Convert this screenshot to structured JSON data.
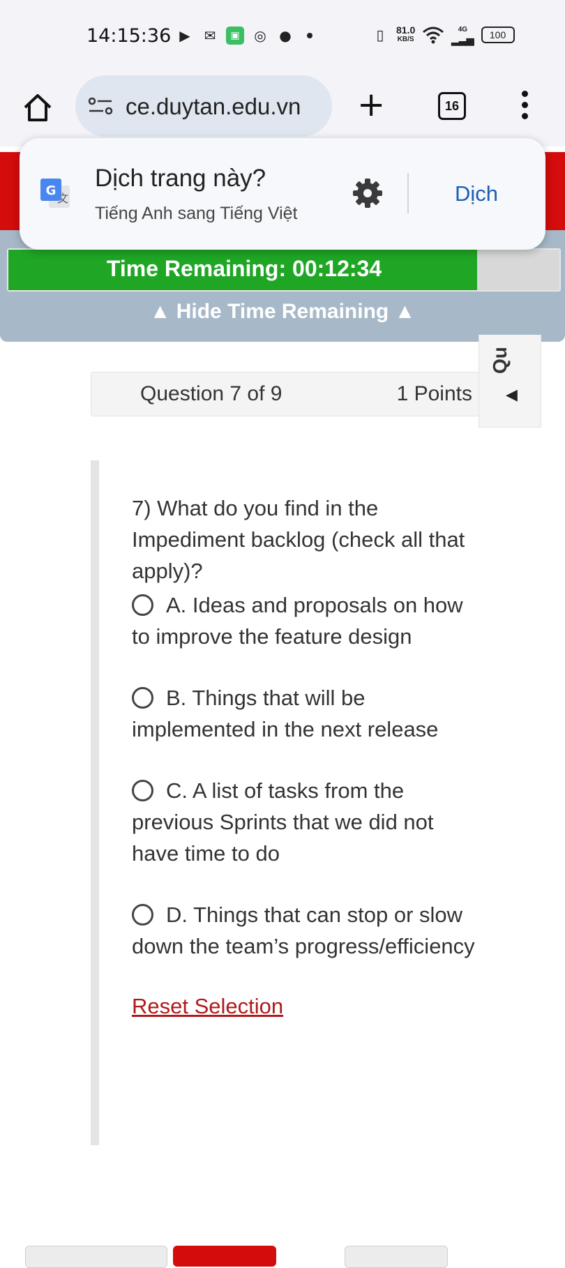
{
  "status_bar": {
    "time": "14:15:36",
    "net_speed_value": "81.0",
    "net_speed_unit": "KB/S",
    "network_type": "4G",
    "battery": "100",
    "icons": [
      "video-icon",
      "gmail-icon",
      "app-icon",
      "instagram-icon",
      "messenger-icon",
      "vibrate-icon",
      "wifi-icon",
      "signal-icon",
      "battery-icon"
    ]
  },
  "browser": {
    "url": "ce.duytan.edu.vn",
    "tab_count": "16"
  },
  "translate_popup": {
    "title": "Dịch trang này?",
    "subtitle": "Tiếng Anh sang Tiếng Việt",
    "action": "Dịch"
  },
  "timer": {
    "text": "Time Remaining: 00:12:34",
    "toggle": "▲ Hide Time Remaining ▲",
    "progress": 0.85,
    "fill_color": "#1fa625"
  },
  "question_header": {
    "number": "Question 7 of 9",
    "points": "1 Points",
    "side_tab_label": "Qu"
  },
  "question": {
    "text": "7) What do you find in the Impediment backlog (check all that apply)?",
    "options": [
      "A. Ideas and proposals on how to improve the feature design",
      "B. Things that will be implemented in the next release",
      "C. A list of tasks from the previous Sprints that we did not have time to do",
      "D. Things that can stop or slow down the team’s progress/efficiency"
    ],
    "reset_label": "Reset Selection"
  },
  "colors": {
    "brand_red": "#d40c0c",
    "timer_bg": "#a7b9c8",
    "link_red": "#b01a1a",
    "translate_action": "#1a5fb4"
  }
}
